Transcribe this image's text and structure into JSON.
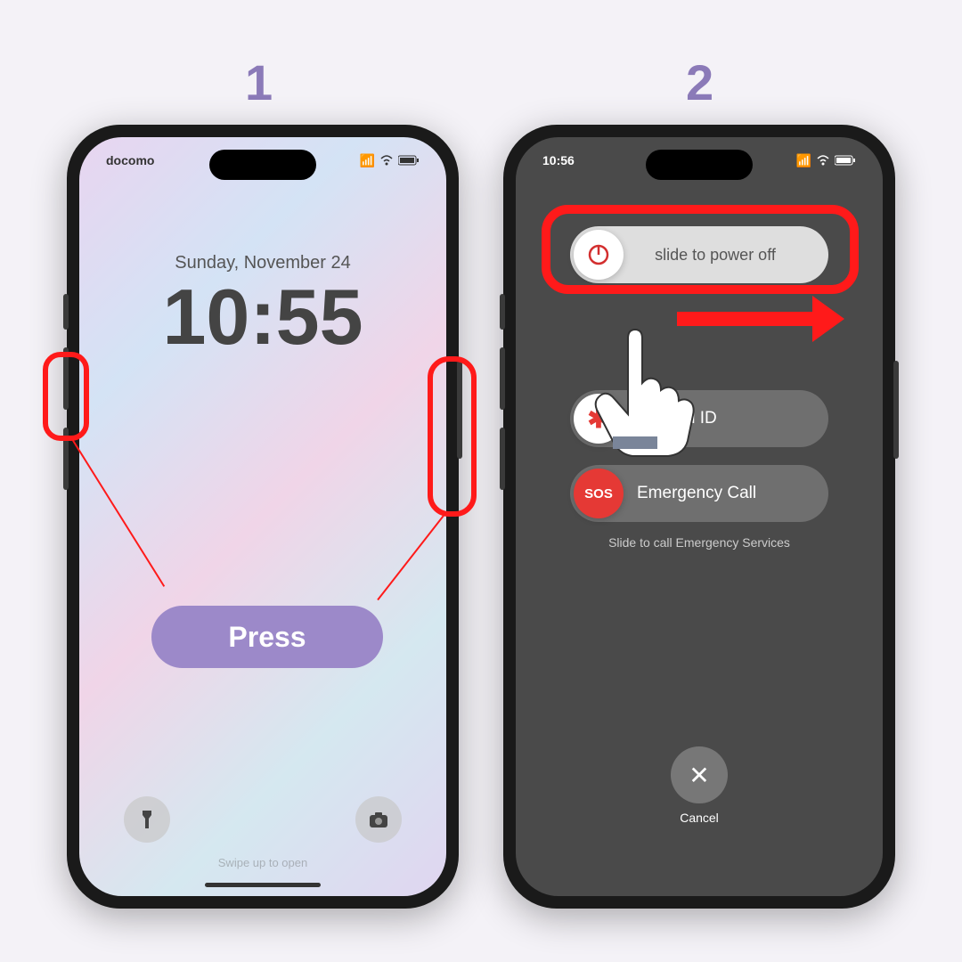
{
  "steps": {
    "one": "1",
    "two": "2"
  },
  "phone1": {
    "carrier": "docomo",
    "date": "Sunday, November 24",
    "time": "10:55",
    "swipe_hint": "Swipe up to open"
  },
  "phone2": {
    "time": "10:56",
    "power_off": "slide to power off",
    "medical_id": "Medical ID",
    "sos_label": "SOS",
    "emergency": "Emergency Call",
    "emergency_note": "Slide to call Emergency Services",
    "cancel": "Cancel"
  },
  "annotations": {
    "press": "Press"
  }
}
